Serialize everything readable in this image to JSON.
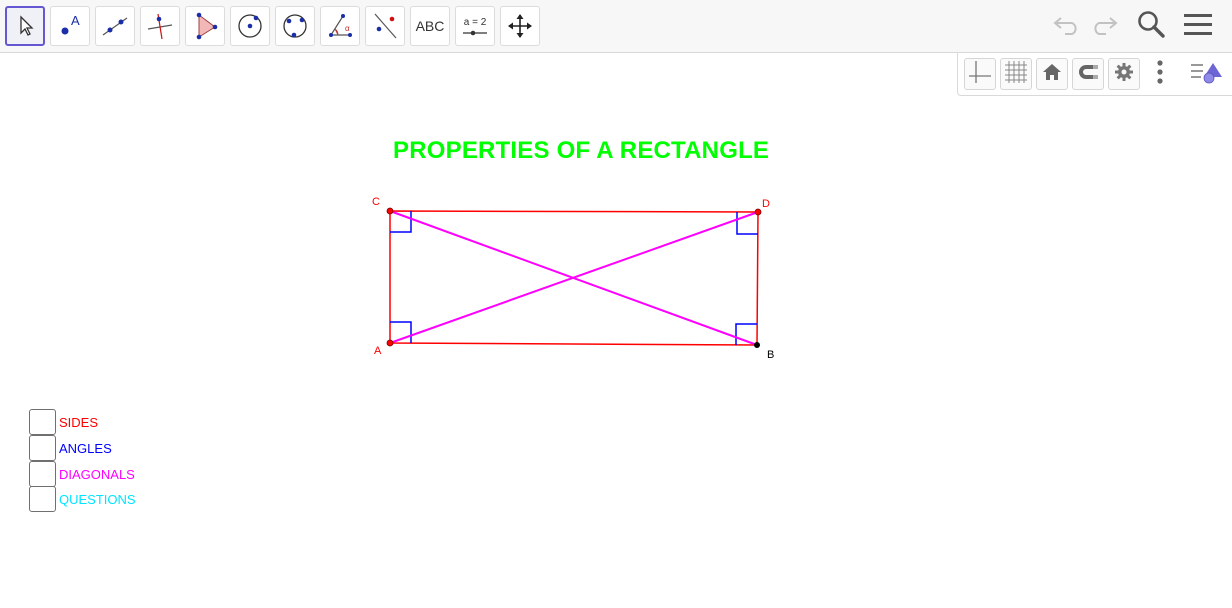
{
  "toolbar": {
    "tools": [
      {
        "id": "move",
        "icon": "cursor-arrow-icon"
      },
      {
        "id": "point",
        "icon": "point-icon",
        "glyph": "A"
      },
      {
        "id": "line",
        "icon": "line-through-points-icon"
      },
      {
        "id": "perpendicular",
        "icon": "perpendicular-line-icon"
      },
      {
        "id": "polygon",
        "icon": "polygon-icon"
      },
      {
        "id": "circle-center",
        "icon": "circle-center-point-icon"
      },
      {
        "id": "circle-three",
        "icon": "circle-three-points-icon"
      },
      {
        "id": "angle",
        "icon": "angle-icon",
        "glyph": "α"
      },
      {
        "id": "reflect",
        "icon": "reflect-about-line-icon"
      },
      {
        "id": "text",
        "icon": "text-tool-icon",
        "label": "ABC"
      },
      {
        "id": "slider",
        "icon": "slider-icon",
        "label": "a = 2"
      },
      {
        "id": "move-view",
        "icon": "move-graphics-view-icon"
      }
    ],
    "selected": "move"
  },
  "graphics_style_bar": {
    "buttons": [
      "axes-icon",
      "grid-icon",
      "home-icon",
      "snap-magnet-icon",
      "settings-gear-icon",
      "more-vertical-icon",
      "style-bar-toggle-icon"
    ]
  },
  "canvas": {
    "title": "PROPERTIES OF A RECTANGLE",
    "title_color": "#00ff00",
    "points": [
      {
        "label": "A",
        "color": "#ff0000"
      },
      {
        "label": "B",
        "color": "#000000"
      },
      {
        "label": "C",
        "color": "#ff0000"
      },
      {
        "label": "D",
        "color": "#ff0000"
      }
    ],
    "side_color": "#ff0000",
    "angle_marker_color": "#0000ff",
    "diagonal_color": "#ff00ff"
  },
  "checkboxes": [
    {
      "label": "SIDES",
      "color": "#ff0000",
      "checked": false
    },
    {
      "label": "ANGLES",
      "color": "#0000ff",
      "checked": false
    },
    {
      "label": "DIAGONALS",
      "color": "#ff00ff",
      "checked": false
    },
    {
      "label": "QUESTIONS",
      "color": "#00e5ff",
      "checked": false
    }
  ]
}
